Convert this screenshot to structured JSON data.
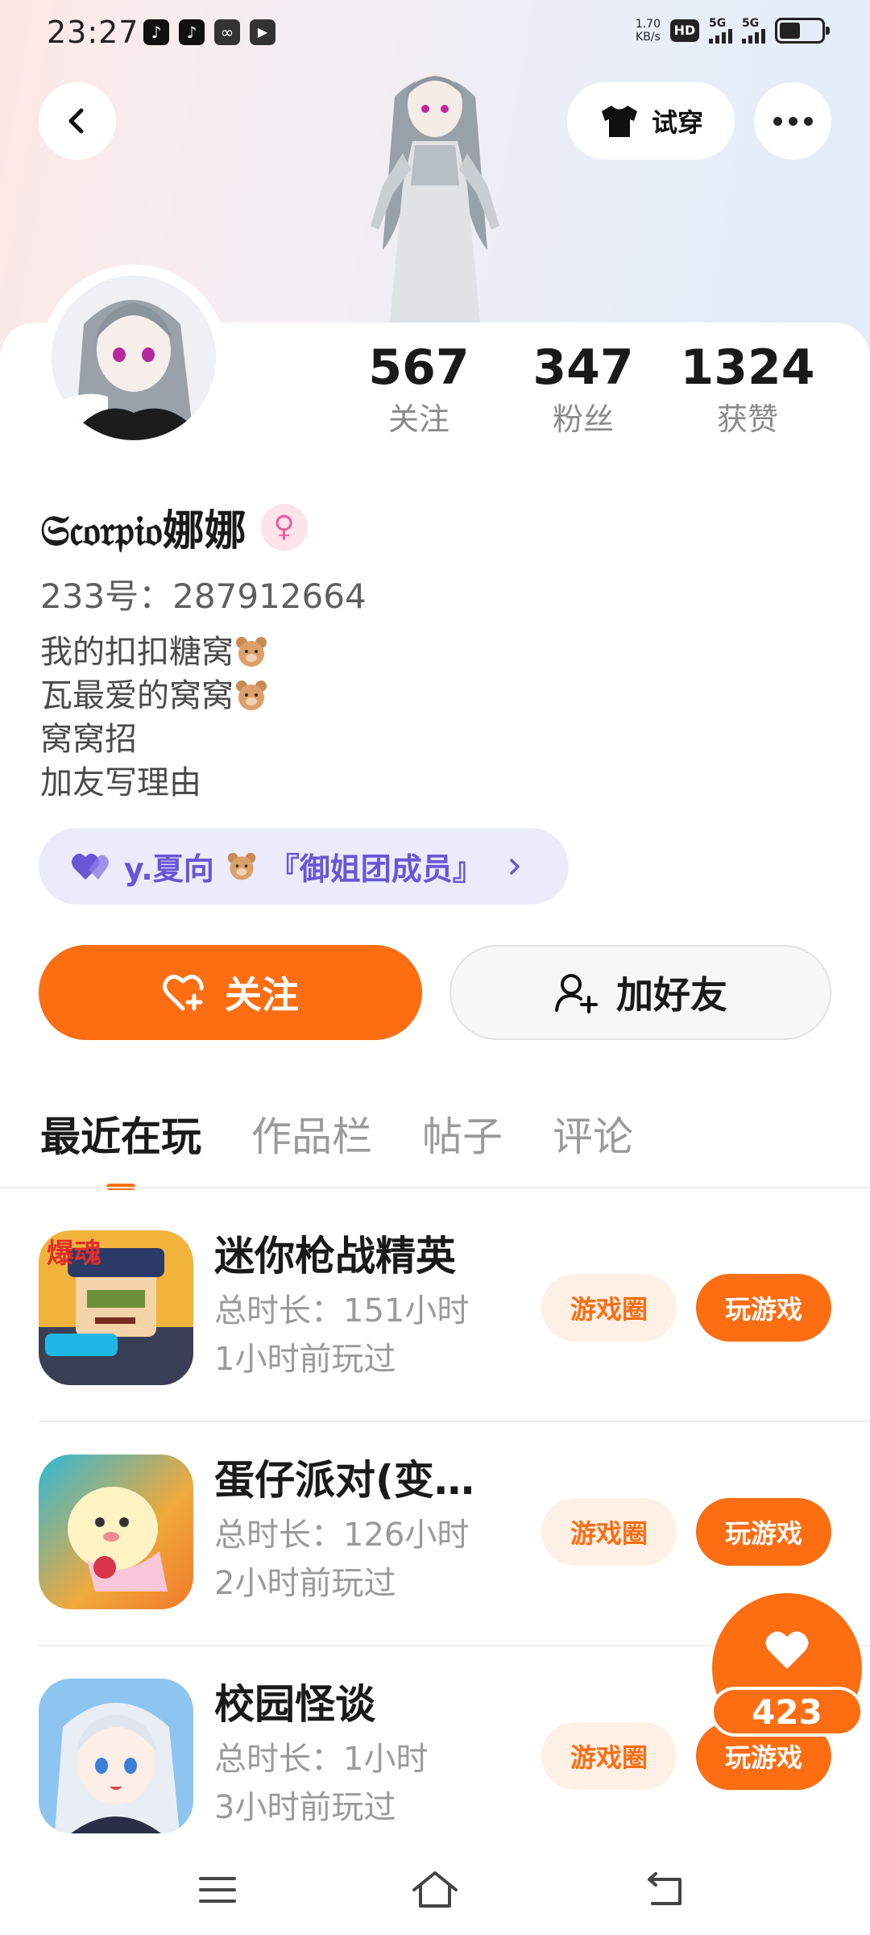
{
  "status_bar": {
    "time": "23:27",
    "net_speed_value": "1.70",
    "net_speed_unit": "KB/s",
    "hd_label": "HD",
    "sim1_label": "5G",
    "sim2_label": "5G",
    "battery_level": 0.5,
    "app_icons": [
      "tiktok-lite-icon",
      "tiktok-icon",
      "soul-icon",
      "play-icon"
    ]
  },
  "header": {
    "back_icon": "chevron-left-icon",
    "try_on_label": "试穿",
    "try_on_icon": "tshirt-icon",
    "more_icon": "more-dots-icon"
  },
  "profile": {
    "stats": [
      {
        "value": "567",
        "label": "关注"
      },
      {
        "value": "347",
        "label": "粉丝"
      },
      {
        "value": "1324",
        "label": "获赞"
      }
    ],
    "username": "𝔖𝔠𝔬𝔯𝔭𝔦𝔬娜娜",
    "gender": "female",
    "uid": "233号：287912664",
    "bio": [
      {
        "text": "我的扣扣糖窝",
        "emoji": "bear"
      },
      {
        "text": "瓦最爱的窝窝",
        "emoji": "bear"
      },
      {
        "text": "窝窝招",
        "emoji": ""
      },
      {
        "text": "加友写理由",
        "emoji": ""
      }
    ],
    "group_tag": {
      "prefix": "y.夏向",
      "suffix": "『御姐团成员』",
      "color": "#6757d6"
    }
  },
  "actions": {
    "follow_label": "关注",
    "add_friend_label": "加好友"
  },
  "tabs": [
    {
      "label": "最近在玩",
      "active": true
    },
    {
      "label": "作品栏",
      "active": false
    },
    {
      "label": "帖子",
      "active": false
    },
    {
      "label": "评论",
      "active": false
    }
  ],
  "games": [
    {
      "name": "迷你枪战精英",
      "total": "总时长：151小时",
      "last": "1小时前玩过",
      "circle_label": "游戏圈",
      "play_label": "玩游戏",
      "icon_badge": "爆魂"
    },
    {
      "name": "蛋仔派对(变…",
      "total": "总时长：126小时",
      "last": "2小时前玩过",
      "circle_label": "游戏圈",
      "play_label": "玩游戏"
    },
    {
      "name": "校园怪谈",
      "total": "总时长：1小时",
      "last": "3小时前玩过",
      "circle_label": "游戏圈",
      "play_label": "玩游戏"
    }
  ],
  "like_fab": {
    "count": "423",
    "icon": "heart-icon"
  },
  "nav_bar": {
    "icons": [
      "menu-icon",
      "home-icon",
      "back-icon"
    ]
  },
  "colors": {
    "accent": "#fd6d12",
    "accent_light": "#fff0e6",
    "group_bg": "#ecebfb",
    "gender_pink": "#e9609a"
  }
}
